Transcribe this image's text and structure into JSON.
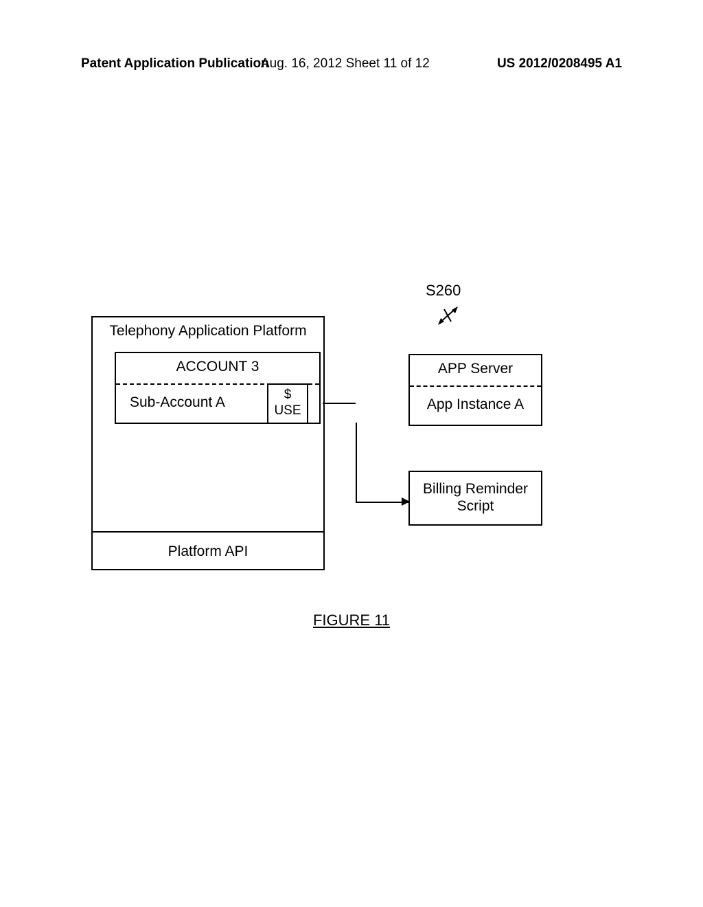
{
  "header": {
    "left": "Patent Application Publication",
    "center": "Aug. 16, 2012  Sheet 11 of 12",
    "right": "US 2012/0208495 A1"
  },
  "diagram": {
    "s260_label": "S260",
    "platform_title": "Telephony Application Platform",
    "account_title": "ACCOUNT 3",
    "subaccount_label": "Sub-Account A",
    "usage_line1": "$",
    "usage_line2": "USE",
    "platform_api": "Platform API",
    "app_server_title": "APP Server",
    "app_instance_label": "App Instance A",
    "billing_line1": "Billing Reminder",
    "billing_line2": "Script",
    "figure_label": "FIGURE 11"
  }
}
